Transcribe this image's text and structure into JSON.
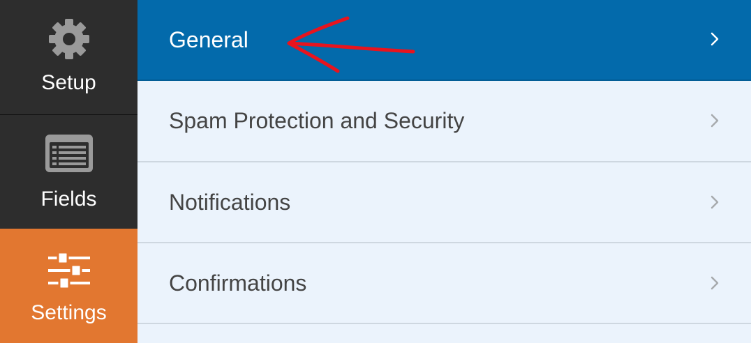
{
  "sidebar": {
    "items": [
      {
        "label": "Setup",
        "icon": "gear-icon"
      },
      {
        "label": "Fields",
        "icon": "form-fields-icon"
      },
      {
        "label": "Settings",
        "icon": "sliders-icon"
      }
    ],
    "active_color": "#e27730",
    "background": "#2d2d2d"
  },
  "menu": {
    "items": [
      {
        "label": "General",
        "active": true
      },
      {
        "label": "Spam Protection and Security",
        "active": false
      },
      {
        "label": "Notifications",
        "active": false
      },
      {
        "label": "Confirmations",
        "active": false
      }
    ],
    "active_color": "#036aab",
    "background": "#ebf3fc"
  },
  "annotation": {
    "type": "red-arrow",
    "points_to": "General",
    "color": "#e8141e"
  }
}
